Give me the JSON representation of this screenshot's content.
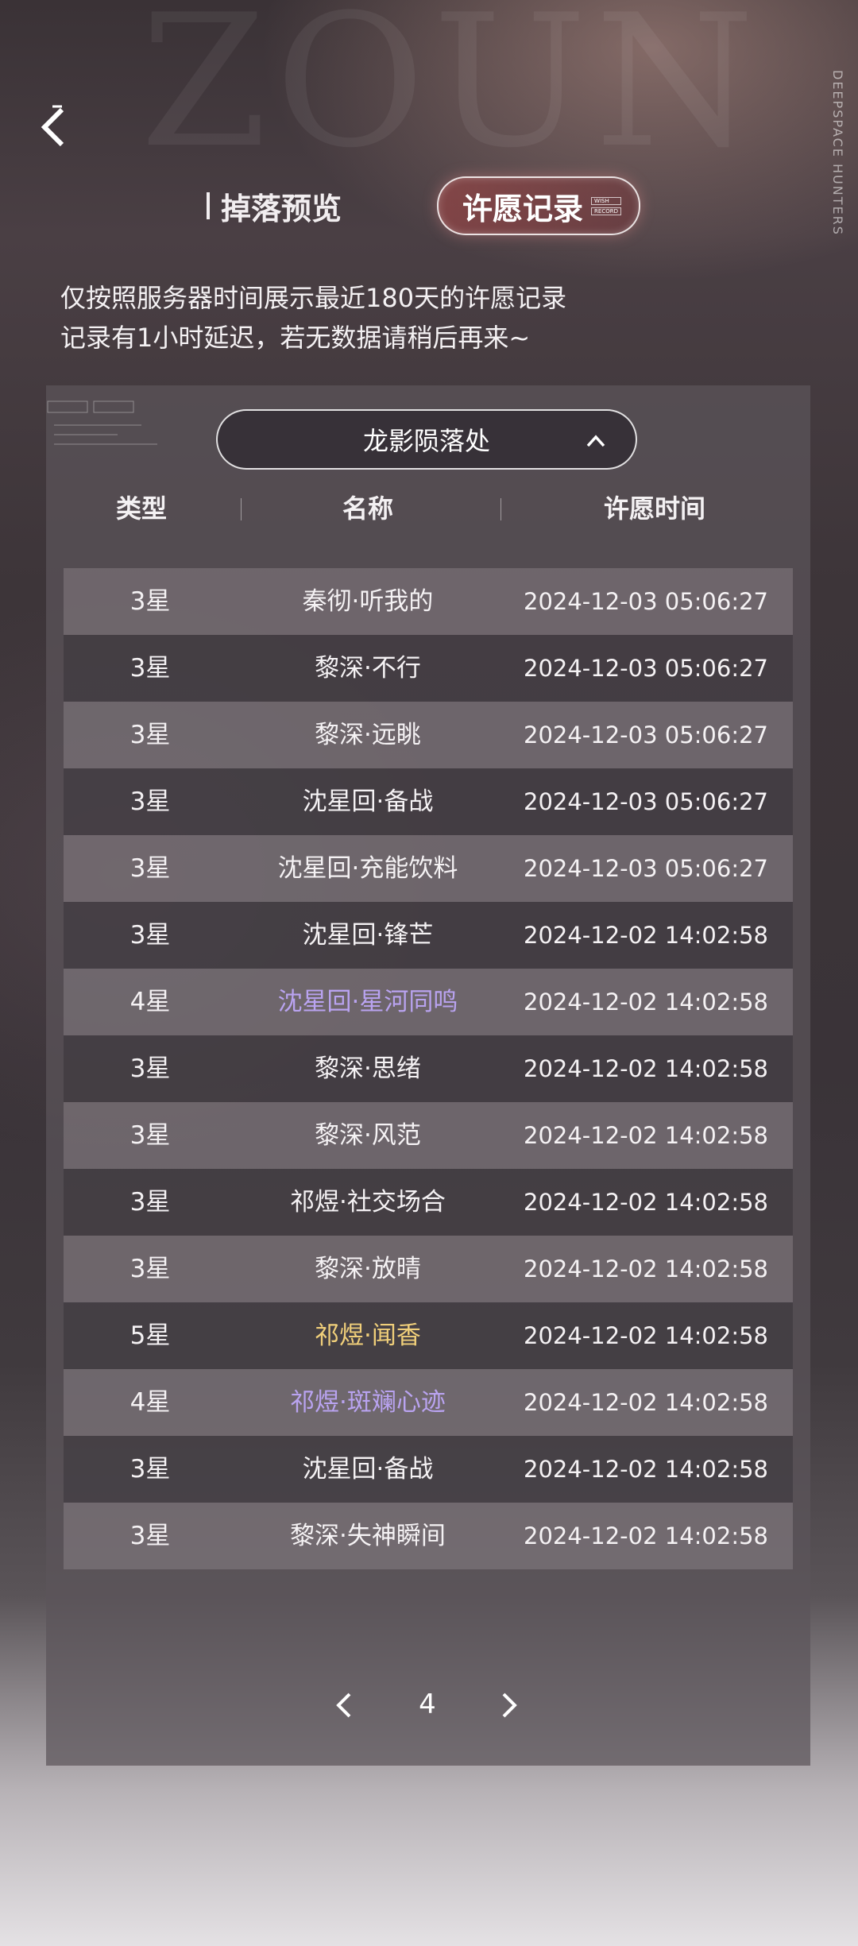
{
  "header": {
    "decor_text": "ZOUN",
    "brand": "DEEPSPACE HUNTERS"
  },
  "tabs": {
    "drops_label": "掉落预览",
    "record_label": "许愿记录",
    "record_mini": [
      "WISH",
      "RECORD"
    ]
  },
  "notice": {
    "line1": "仅按照服务器时间展示最近180天的许愿记录",
    "line2": "记录有1小时延迟，若无数据请稍后再来~"
  },
  "pool_select": {
    "value": "龙影陨落处"
  },
  "table": {
    "headers": [
      "类型",
      "名称",
      "许愿时间"
    ],
    "rows": [
      {
        "type": "3星",
        "name": "秦彻·听我的",
        "time": "2024-12-03 05:06:27",
        "rarity": 3
      },
      {
        "type": "3星",
        "name": "黎深·不行",
        "time": "2024-12-03 05:06:27",
        "rarity": 3
      },
      {
        "type": "3星",
        "name": "黎深·远眺",
        "time": "2024-12-03 05:06:27",
        "rarity": 3
      },
      {
        "type": "3星",
        "name": "沈星回·备战",
        "time": "2024-12-03 05:06:27",
        "rarity": 3
      },
      {
        "type": "3星",
        "name": "沈星回·充能饮料",
        "time": "2024-12-03 05:06:27",
        "rarity": 3
      },
      {
        "type": "3星",
        "name": "沈星回·锋芒",
        "time": "2024-12-02 14:02:58",
        "rarity": 3
      },
      {
        "type": "4星",
        "name": "沈星回·星河同鸣",
        "time": "2024-12-02 14:02:58",
        "rarity": 4
      },
      {
        "type": "3星",
        "name": "黎深·思绪",
        "time": "2024-12-02 14:02:58",
        "rarity": 3
      },
      {
        "type": "3星",
        "name": "黎深·风范",
        "time": "2024-12-02 14:02:58",
        "rarity": 3
      },
      {
        "type": "3星",
        "name": "祁煜·社交场合",
        "time": "2024-12-02 14:02:58",
        "rarity": 3
      },
      {
        "type": "3星",
        "name": "黎深·放晴",
        "time": "2024-12-02 14:02:58",
        "rarity": 3
      },
      {
        "type": "5星",
        "name": "祁煜·闻香",
        "time": "2024-12-02 14:02:58",
        "rarity": 5
      },
      {
        "type": "4星",
        "name": "祁煜·斑斓心迹",
        "time": "2024-12-02 14:02:58",
        "rarity": 4
      },
      {
        "type": "3星",
        "name": "沈星回·备战",
        "time": "2024-12-02 14:02:58",
        "rarity": 3
      },
      {
        "type": "3星",
        "name": "黎深·失神瞬间",
        "time": "2024-12-02 14:02:58",
        "rarity": 3
      }
    ]
  },
  "rarity_colors": {
    "3": "#f5f2f4",
    "4": "#b9a3f0",
    "5": "#f0cf7a"
  },
  "pagination": {
    "current_page": "4"
  },
  "icons": {
    "back": "back-chevron-icon",
    "dropdown": "chevron-up-icon",
    "prev": "chevron-left-icon",
    "next": "chevron-right-icon"
  }
}
